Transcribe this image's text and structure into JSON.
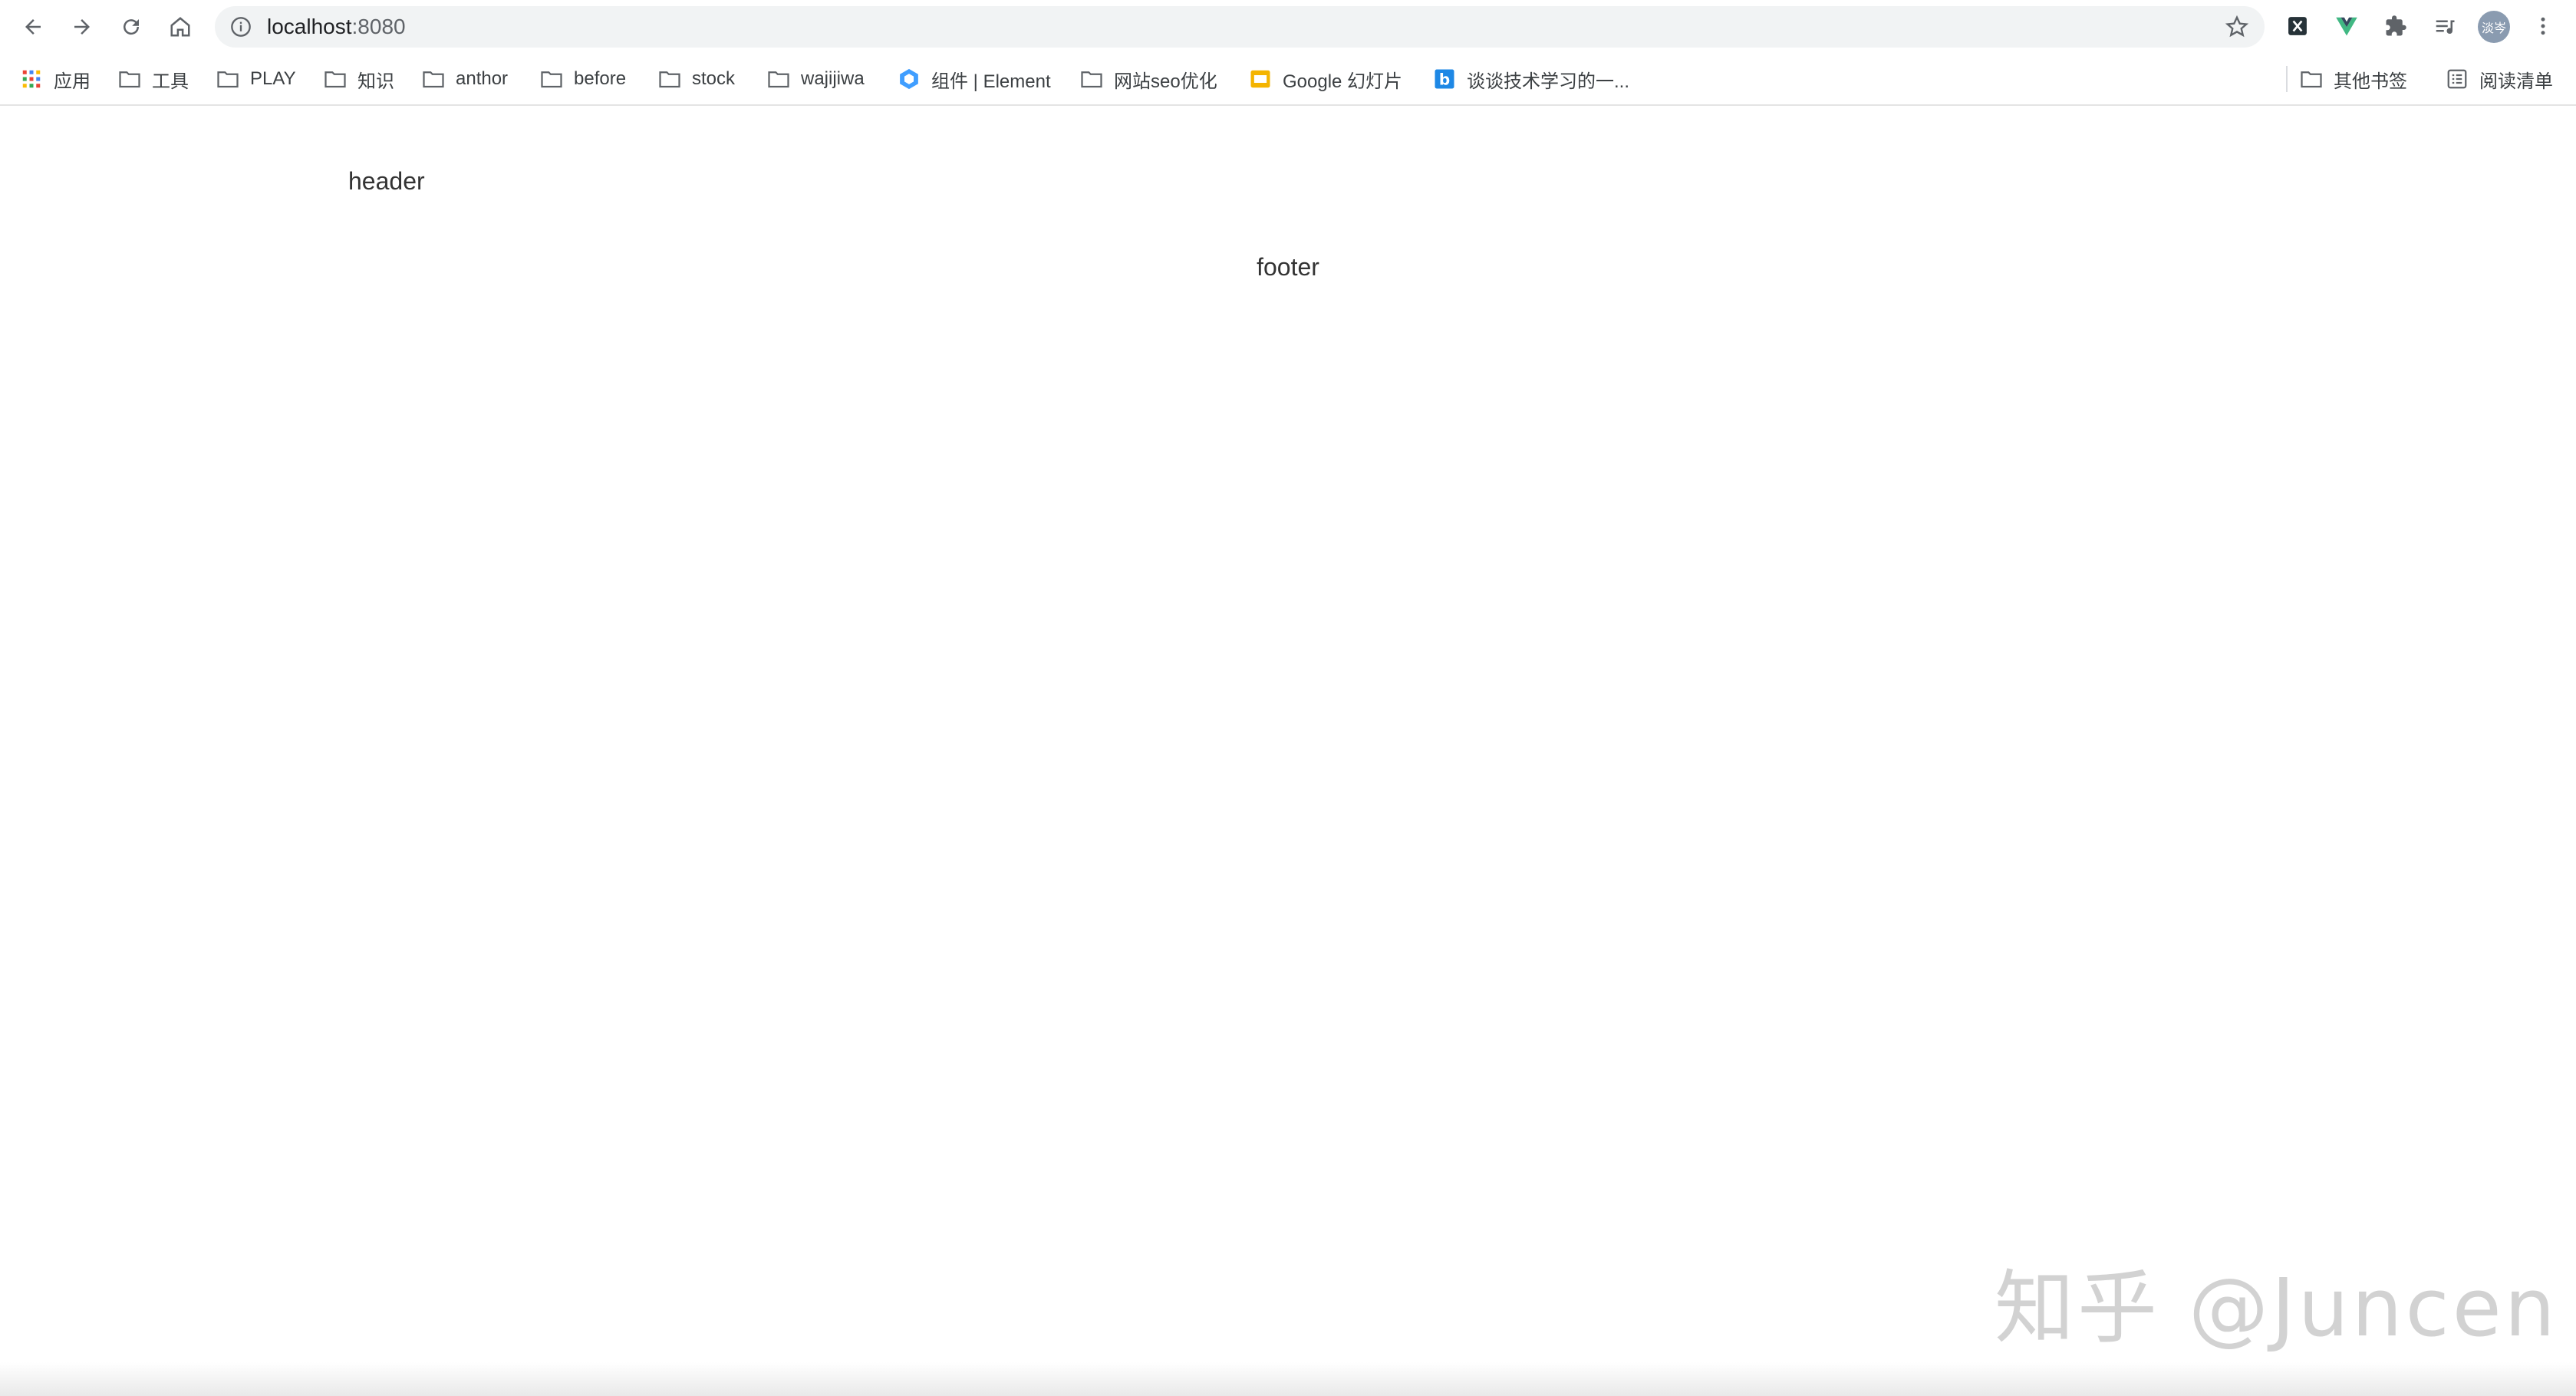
{
  "browser": {
    "url_host": "localhost",
    "url_port": ":8080",
    "profile_initials": "淡岑"
  },
  "bookmarks": [
    {
      "label": "应用",
      "icon": "apps-grid-icon"
    },
    {
      "label": "工具",
      "icon": "folder-icon"
    },
    {
      "label": "PLAY",
      "icon": "folder-icon"
    },
    {
      "label": "知识",
      "icon": "folder-icon"
    },
    {
      "label": "anthor",
      "icon": "folder-icon"
    },
    {
      "label": "before",
      "icon": "folder-icon"
    },
    {
      "label": "stock",
      "icon": "folder-icon"
    },
    {
      "label": "wajijiwa",
      "icon": "folder-icon"
    },
    {
      "label": "组件 | Element",
      "icon": "element-logo-icon"
    },
    {
      "label": "网站seo优化",
      "icon": "folder-icon"
    },
    {
      "label": "Google 幻灯片",
      "icon": "google-slides-icon"
    },
    {
      "label": "谈谈技术学习的一...",
      "icon": "blog-b-icon"
    }
  ],
  "bookmarks_right": {
    "other": "其他书签",
    "reading_list": "阅读清单"
  },
  "page": {
    "header": "header",
    "footer": "footer"
  },
  "watermark": "知乎 @Juncen"
}
